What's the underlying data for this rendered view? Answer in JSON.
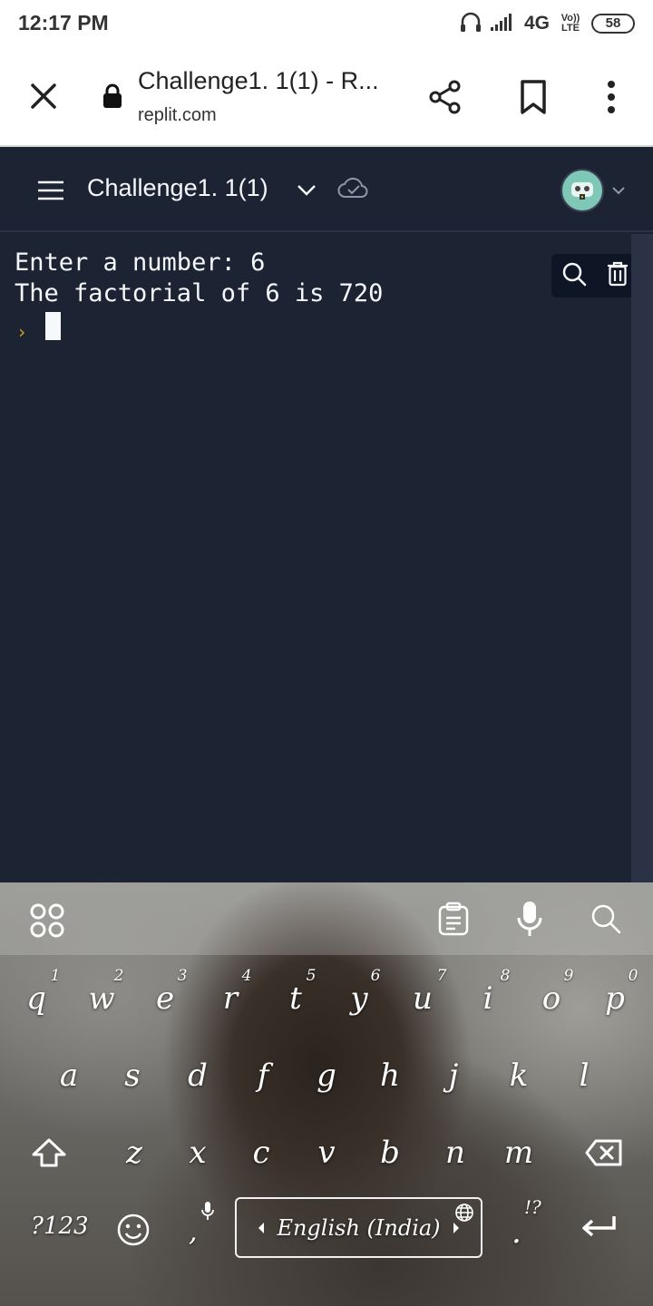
{
  "status_bar": {
    "time": "12:17 PM",
    "network": "4G",
    "volte_label": "Vo)) LTE",
    "battery": "58",
    "icons": [
      "headphones-icon",
      "signal-icon",
      "battery-icon"
    ]
  },
  "browser": {
    "page_title": "Challenge1. 1(1) - R...",
    "url": "replit.com",
    "icons": [
      "close-icon",
      "lock-icon",
      "share-icon",
      "bookmark-icon",
      "more-vertical-icon"
    ]
  },
  "app": {
    "repl_name": "Challenge1. 1(1)",
    "icons": [
      "hamburger-menu-icon",
      "chevron-down-icon",
      "cloud-check-icon",
      "avatar",
      "chevron-down-icon"
    ]
  },
  "console": {
    "lines": [
      "Enter a number: 6",
      "The factorial of 6 is 720"
    ],
    "prompt_symbol": "›",
    "tool_icons": [
      "search-icon",
      "trash-icon"
    ]
  },
  "keyboard": {
    "toolbar_icons": [
      "apps-grid-icon",
      "clipboard-icon",
      "microphone-icon",
      "search-icon"
    ],
    "row1": [
      "q",
      "w",
      "e",
      "r",
      "t",
      "y",
      "u",
      "i",
      "o",
      "p"
    ],
    "row1_hints": [
      "1",
      "2",
      "3",
      "4",
      "5",
      "6",
      "7",
      "8",
      "9",
      "0"
    ],
    "row2": [
      "a",
      "s",
      "d",
      "f",
      "g",
      "h",
      "j",
      "k",
      "l"
    ],
    "row3": [
      "z",
      "x",
      "c",
      "v",
      "b",
      "n",
      "m"
    ],
    "symbols_key": "?123",
    "comma_key": ",",
    "period_key": ".",
    "period_hint": "!?",
    "space_label": "English (India)",
    "icons": [
      "shift-icon",
      "backspace-icon",
      "emoji-icon",
      "microphone-small-icon",
      "globe-icon",
      "enter-icon"
    ]
  }
}
